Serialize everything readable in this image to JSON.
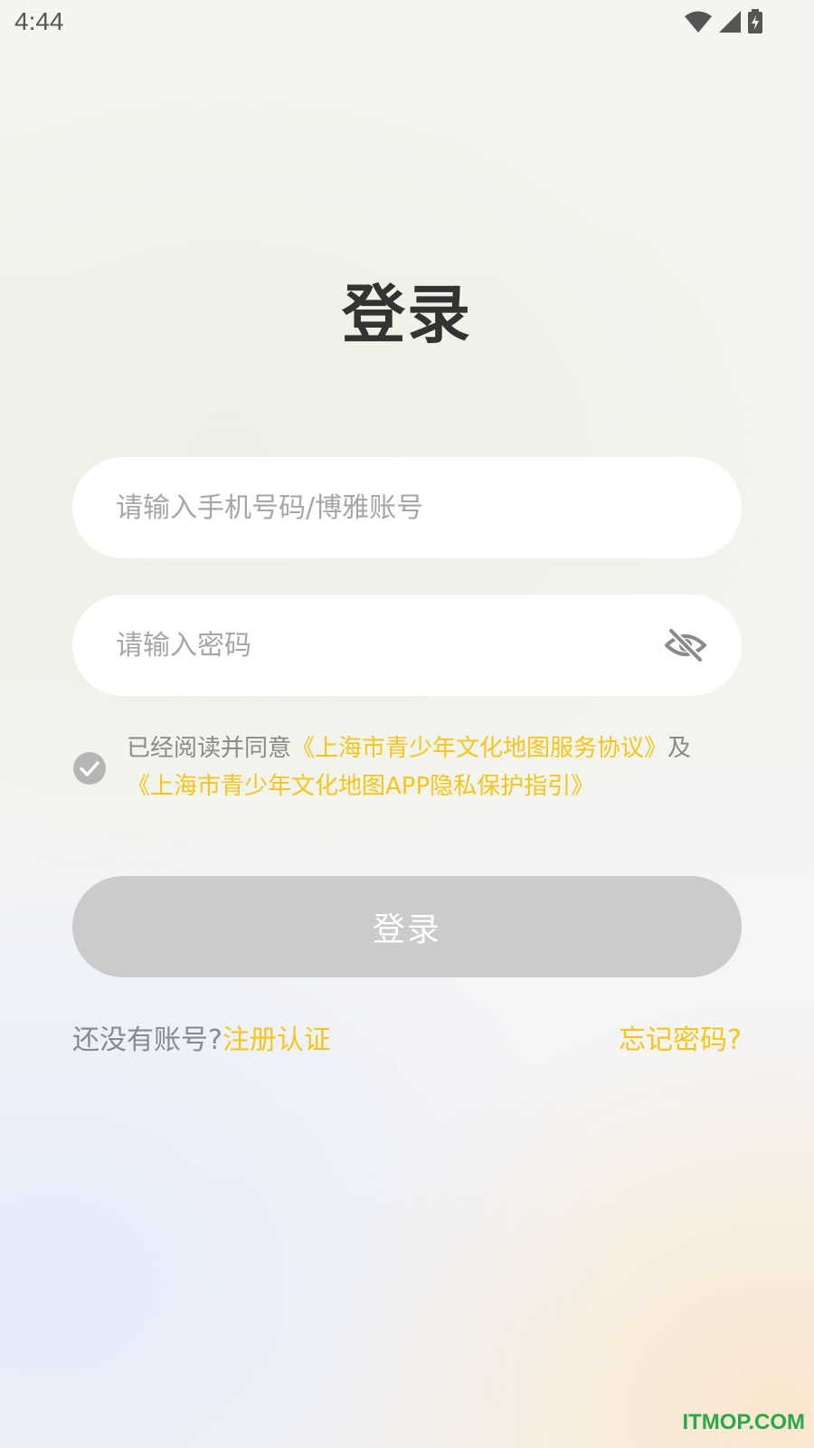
{
  "status_bar": {
    "time": "4:44",
    "icons": [
      "wifi-icon",
      "cellular-signal-icon",
      "battery-charging-icon"
    ]
  },
  "title": "登录",
  "account_field": {
    "placeholder": "请输入手机号码/博雅账号",
    "value": ""
  },
  "password_field": {
    "placeholder": "请输入密码",
    "value": "",
    "toggle_icon": "eye-off-icon"
  },
  "agreement": {
    "checked": true,
    "prefix": "已经阅读并同意",
    "service_link": "《上海市青少年文化地图服务协议》",
    "connector": "及",
    "privacy_link": "《上海市青少年文化地图APP隐私保护指引》"
  },
  "login_button": {
    "label": "登录"
  },
  "footer": {
    "no_account": "还没有账号?",
    "register_link": "注册认证",
    "forgot_password": "忘记密码?"
  },
  "watermark": "ITMOP.COM",
  "colors": {
    "accent": "#f5c518",
    "button_disabled": "#cbcbcb",
    "title": "#333333",
    "muted_text": "#8a8a8a"
  }
}
